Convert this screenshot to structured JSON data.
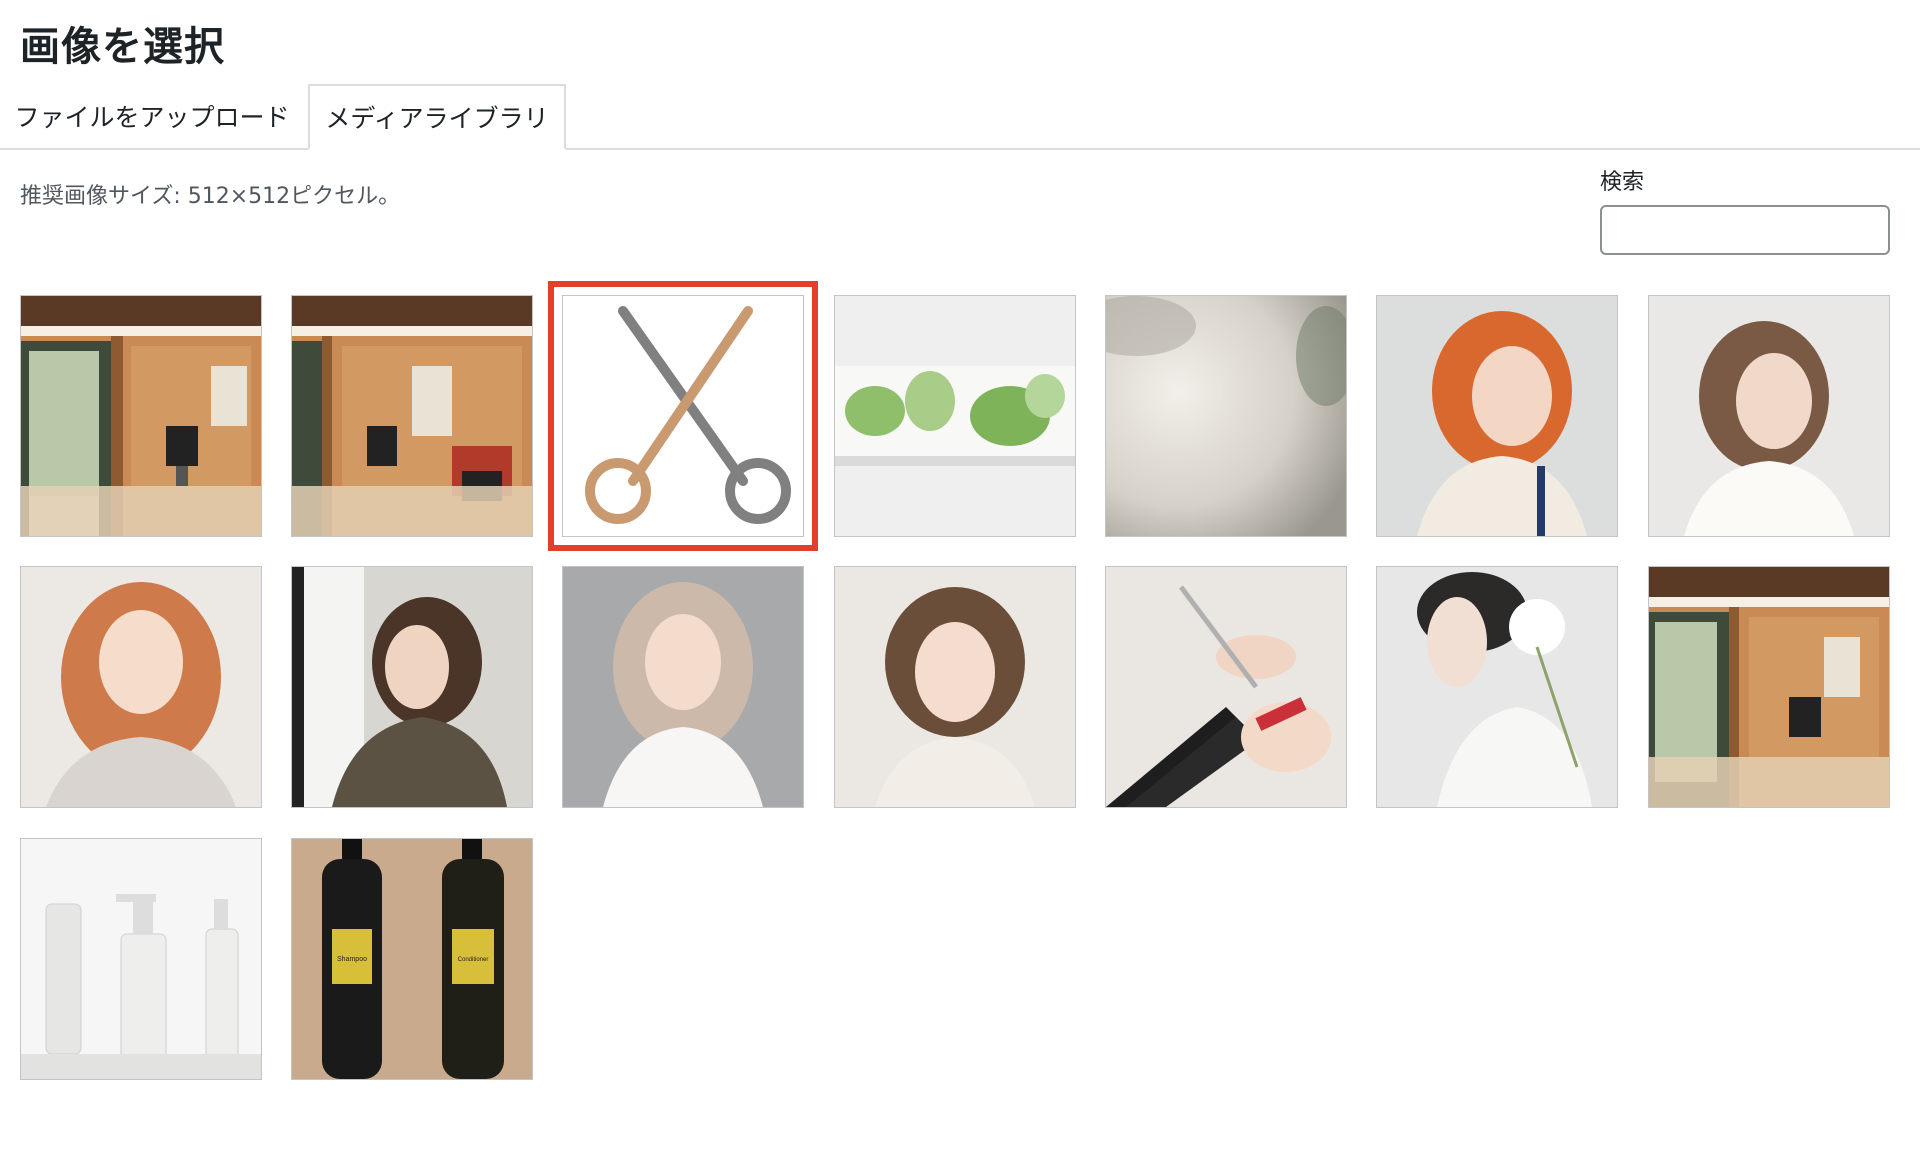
{
  "dialog": {
    "title": "画像を選択"
  },
  "tabs": [
    {
      "label": "ファイルをアップロード",
      "active": false
    },
    {
      "label": "メディアライブラリ",
      "active": true
    }
  ],
  "hint": "推奨画像サイズ: 512×512ピクセル。",
  "search": {
    "label": "検索",
    "value": "",
    "placeholder": ""
  },
  "media": [
    {
      "subject": "salon-interior",
      "selected": false
    },
    {
      "subject": "salon-interior-red-chair",
      "selected": false
    },
    {
      "subject": "scissors-logo",
      "selected": true
    },
    {
      "subject": "green-plants-banner",
      "selected": false
    },
    {
      "subject": "blurred-neutral-background",
      "selected": false
    },
    {
      "subject": "woman-orange-hair",
      "selected": false
    },
    {
      "subject": "woman-brown-bob",
      "selected": false
    },
    {
      "subject": "woman-wavy-orange-hair",
      "selected": false
    },
    {
      "subject": "woman-by-window",
      "selected": false
    },
    {
      "subject": "woman-ash-blonde-hair",
      "selected": false
    },
    {
      "subject": "woman-short-bob",
      "selected": false
    },
    {
      "subject": "hairdresser-cutting",
      "selected": false
    },
    {
      "subject": "woman-with-flower",
      "selected": false
    },
    {
      "subject": "salon-interior-2",
      "selected": false
    },
    {
      "subject": "clear-bottles",
      "selected": false
    },
    {
      "subject": "shampoo-conditioner-bottles",
      "selected": false,
      "labels": [
        "Shampoo",
        "Conditioner"
      ]
    }
  ],
  "colors": {
    "selection_border": "#e2402a",
    "scissors_tan": "#c99a70",
    "scissors_gray": "#808080"
  }
}
